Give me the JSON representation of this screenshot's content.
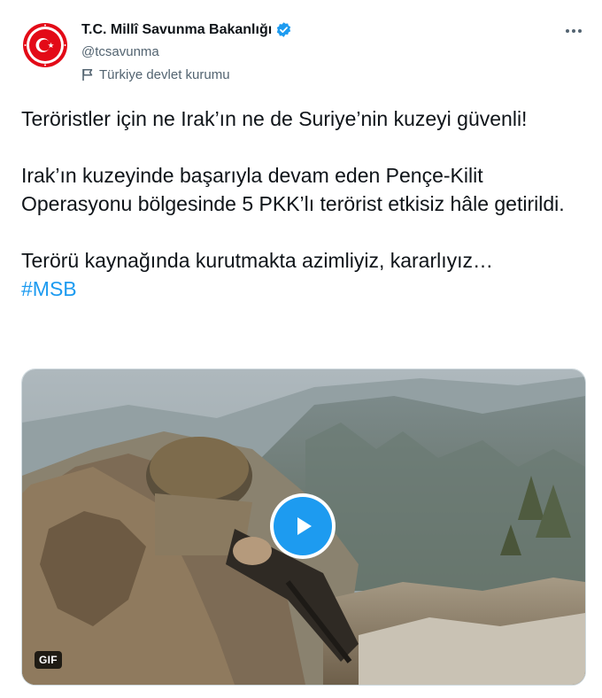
{
  "account": {
    "display_name": "T.C. Millî Savunma Bakanlığı",
    "handle": "@tcsavunma",
    "label": "Türkiye devlet kurumu",
    "avatar_icon": "msb-emblem-icon",
    "verified_icon": "verified-badge-icon"
  },
  "tweet": {
    "paragraph_1": "Teröristler için ne Irak’ın ne de Suriye’nin kuzeyi güvenli!",
    "paragraph_2": "Irak’ın kuzeyinde başarıyla devam eden Pençe-Kilit Operasyonu bölgesinde 5 PKK’lı terörist etkisiz hâle getirildi.",
    "paragraph_3": "Terörü kaynağında kurutmakta azimliyiz, kararlıyız…",
    "hashtag": "#MSB"
  },
  "media": {
    "badge": "GIF",
    "play_icon": "play-icon"
  },
  "colors": {
    "accent": "#1d9bf0",
    "text": "#0f1419",
    "muted": "#536471",
    "emblem_red": "#e30a17"
  }
}
